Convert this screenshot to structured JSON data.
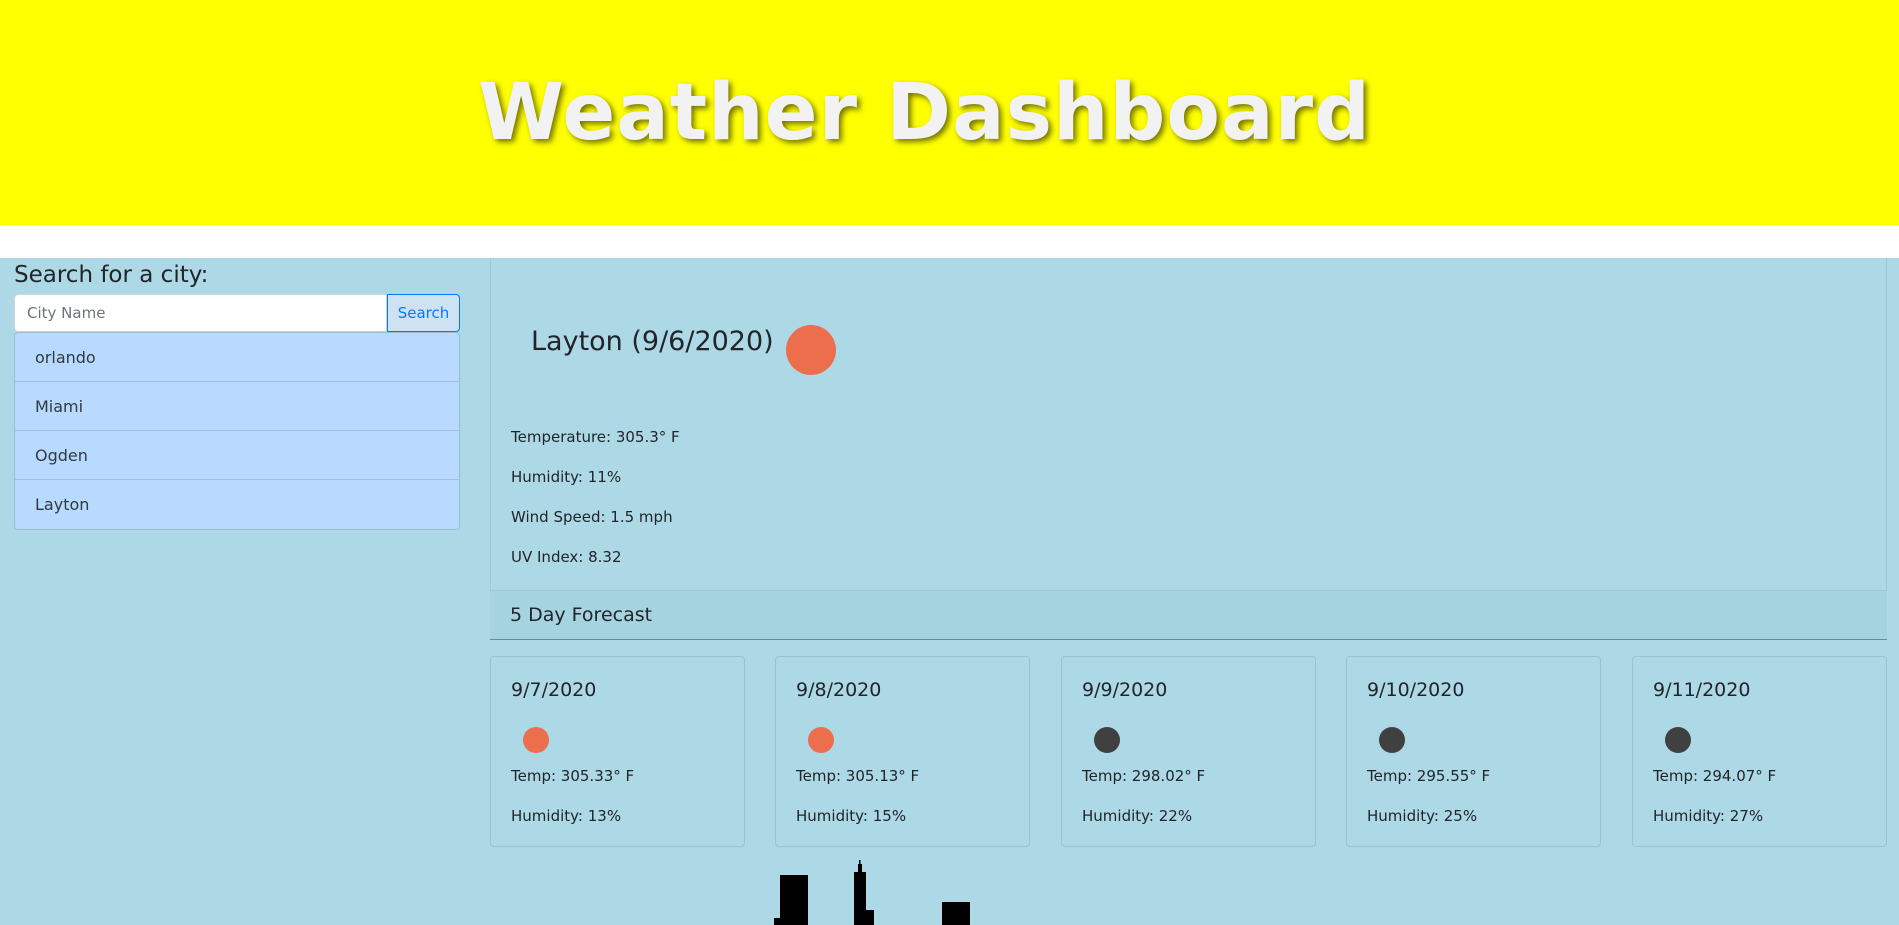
{
  "header": {
    "title": "Weather Dashboard"
  },
  "search": {
    "label": "Search for a city:",
    "placeholder": "City Name",
    "value": "",
    "button_label": "Search"
  },
  "history": [
    "orlando",
    "Miami",
    "Ogden",
    "Layton"
  ],
  "current": {
    "title": "Layton (9/6/2020)",
    "icon": "sun-icon",
    "temperature": "Temperature: 305.3° F",
    "humidity": "Humidity: 11%",
    "wind": "Wind Speed: 1.5 mph",
    "uv": "UV Index: 8.32"
  },
  "forecast": {
    "heading": "5 Day Forecast",
    "days": [
      {
        "date": "9/7/2020",
        "icon": "sun-icon",
        "temp": "Temp: 305.33° F",
        "humidity": "Humidity: 13%"
      },
      {
        "date": "9/8/2020",
        "icon": "sun-icon",
        "temp": "Temp: 305.13° F",
        "humidity": "Humidity: 15%"
      },
      {
        "date": "9/9/2020",
        "icon": "cloud-icon",
        "temp": "Temp: 298.02° F",
        "humidity": "Humidity: 22%"
      },
      {
        "date": "9/10/2020",
        "icon": "cloud-icon",
        "temp": "Temp: 295.55° F",
        "humidity": "Humidity: 25%"
      },
      {
        "date": "9/11/2020",
        "icon": "cloud-icon",
        "temp": "Temp: 294.07° F",
        "humidity": "Humidity: 27%"
      }
    ]
  },
  "colors": {
    "header_bg": "#ffff00",
    "page_bg": "#add8e6",
    "sun": "#ec6e4c",
    "cloud": "#404040",
    "history_item_bg": "#b8daff",
    "button_text": "#007bff"
  }
}
